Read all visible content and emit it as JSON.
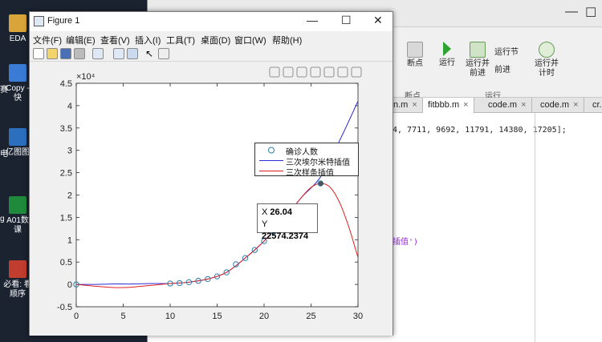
{
  "desktop": {
    "icons": [
      {
        "label": "EDA",
        "top": 18,
        "color": "#d9a43a"
      },
      {
        "label": "Copy - 快",
        "top": 80,
        "color": "#3a7bd5",
        "prefix": "赛"
      },
      {
        "label": "亿图图",
        "top": 160,
        "color": "#2c6fbf",
        "prefix": "电"
      },
      {
        "label": "A01数 课",
        "top": 245,
        "color": "#1f8a3b",
        "prefix": "g"
      },
      {
        "label": "必看: 看顺序",
        "top": 325,
        "color": "#c13d2f"
      }
    ]
  },
  "matlab": {
    "toolbar": {
      "breakpoint_label": "断点",
      "run_label": "运行",
      "run_advance_label": "运行并\n前进",
      "run_section_label": "运行节",
      "advance_label": "前进",
      "run_time_label": "运行并\n计时",
      "section_breakpoint": "断点",
      "section_run": "运行"
    },
    "tabs": [
      {
        "label": "n.m",
        "active": false
      },
      {
        "label": "fitbbb.m",
        "active": true
      },
      {
        "label": "code.m",
        "active": false
      },
      {
        "label": "code.m",
        "active": false
      },
      {
        "label": "cr.",
        "active": false
      }
    ],
    "code_line_1": "4, 7711, 9692, 11791, 14380, 17205];",
    "code_line_2": "插值')"
  },
  "figure": {
    "title": "Figure 1",
    "menu": [
      "文件(F)",
      "编辑(E)",
      "查看(V)",
      "插入(I)",
      "工具(T)",
      "桌面(D)",
      "窗口(W)",
      "帮助(H)"
    ],
    "datatip": {
      "x_label": "X",
      "x_value": "26.04",
      "y_label": "Y",
      "y_value": "22574.2374"
    },
    "legend": [
      "确诊人数",
      "三次埃尔米特插值",
      "三次样条插值"
    ],
    "exponent_label": "×10⁴"
  },
  "chart_data": {
    "type": "line",
    "xlim": [
      0,
      30
    ],
    "ylim": [
      -0.5,
      4.5
    ],
    "y_multiplier": 10000,
    "x_ticks": [
      "0",
      "5",
      "10",
      "15",
      "20",
      "25",
      "30"
    ],
    "y_ticks": [
      "-0.5",
      "0",
      "0.5",
      "1",
      "1.5",
      "2",
      "2.5",
      "3",
      "3.5",
      "4",
      "4.5"
    ],
    "colors": {
      "markers": "#2b7fa8",
      "pchip": "#2d2dd8",
      "spline": "#e02020"
    },
    "series": [
      {
        "name": "确诊人数",
        "kind": "markers",
        "x": [
          0,
          10,
          11,
          12,
          13,
          14,
          15,
          16,
          17,
          18,
          19,
          20,
          21,
          22,
          23,
          26
        ],
        "y": [
          0.0,
          0.02,
          0.03,
          0.05,
          0.08,
          0.12,
          0.18,
          0.27,
          0.45,
          0.59,
          0.77,
          0.97,
          1.18,
          1.44,
          1.72,
          2.26
        ]
      },
      {
        "name": "三次埃尔米特插值",
        "kind": "line",
        "x": [
          0,
          2,
          4,
          6,
          8,
          10,
          12,
          14,
          16,
          18,
          20,
          22,
          24,
          26,
          28,
          30
        ],
        "y": [
          0.0,
          0.0,
          0.01,
          0.01,
          0.02,
          0.02,
          0.05,
          0.12,
          0.27,
          0.59,
          0.97,
          1.44,
          1.95,
          2.4,
          3.2,
          4.1
        ]
      },
      {
        "name": "三次样条插值",
        "kind": "line",
        "x": [
          0,
          2,
          4,
          5,
          6,
          8,
          10,
          12,
          14,
          16,
          18,
          20,
          22,
          24,
          25,
          26,
          27,
          28,
          29,
          30
        ],
        "y": [
          0.0,
          -0.04,
          -0.07,
          -0.07,
          -0.06,
          -0.02,
          0.02,
          0.05,
          0.12,
          0.27,
          0.59,
          0.97,
          1.44,
          1.95,
          2.17,
          2.26,
          2.18,
          1.85,
          1.3,
          0.6
        ]
      }
    ]
  }
}
